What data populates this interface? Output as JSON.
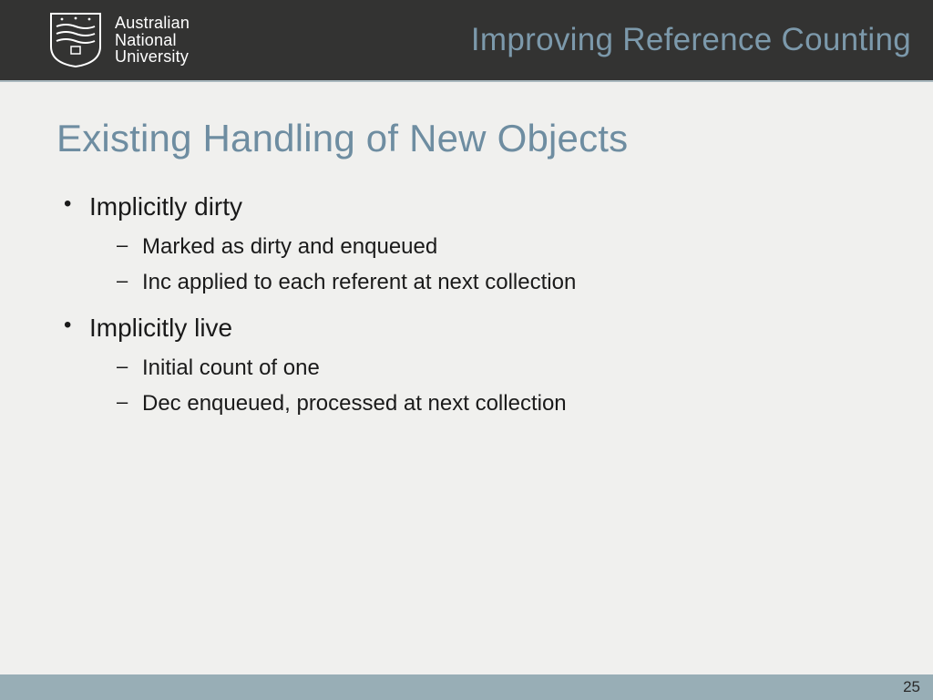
{
  "header": {
    "university_line1": "Australian",
    "university_line2": "National",
    "university_line3": "University",
    "title": "Improving Reference Counting"
  },
  "slide": {
    "title": "Existing Handling of New Objects",
    "bullets": [
      {
        "text": "Implicitly dirty",
        "sub": [
          "Marked as dirty and enqueued",
          "Inc applied to each referent at next collection"
        ]
      },
      {
        "text": "Implicitly live",
        "sub": [
          "Initial count of one",
          "Dec enqueued, processed at next collection"
        ]
      }
    ]
  },
  "footer": {
    "page_number": "25"
  }
}
